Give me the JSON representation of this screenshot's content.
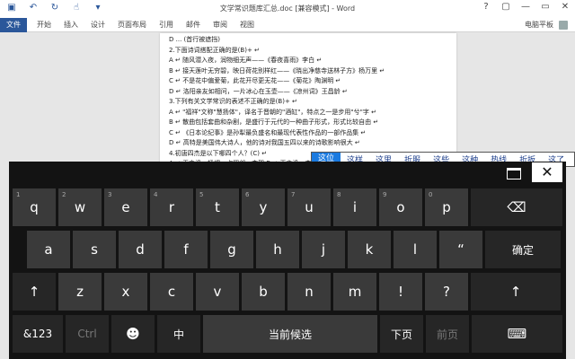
{
  "word": {
    "title": "文学常识题库汇总.doc [兼容模式] - Word",
    "file_tab": "文件",
    "tabs": [
      "开始",
      "插入",
      "设计",
      "页面布局",
      "引用",
      "邮件",
      "审阅",
      "视图"
    ],
    "user": "电脑平板",
    "qat_icons": [
      "save-icon",
      "undo-icon",
      "redo-icon",
      "touch-mode-icon",
      "customize-icon"
    ],
    "window_buttons": [
      "?",
      "▢",
      "—",
      "▭",
      "✕"
    ],
    "doc_lines": [
      "D  ... (首行被遮挡)",
      "2.下面诗词搭配正确的是(B)+ ↵",
      "A ↵ 随风潜入夜，润物细无声——《春夜喜雨》李白 ↵",
      "B ↵ 接天莲叶无穷碧，映日荷花别样红——《晓出净慈寺送林子方》杨万里 ↵",
      "C ↵ 不是花中偏爱菊，此花开尽更无花——《菊花》陶渊明 ↵",
      "D ↵ 洛阳亲友如相问，一片冰心在玉壶——《凉州词》王昌龄 ↵",
      "3.下列有关文学常识的表述不正确的是(B)+ ↵",
      "A ↵ \"福祥\"文称\"慧扬体\"，译名于晋朝的\"酒缸\"，特点之一是步用\"兮\"字 ↵",
      "B ↵ 散曲包括套曲和杂剧，是盛行于元代的一种曲子形式，形式比较自由 ↵",
      "C ↵ 《日本论纪事》是孙犁最负盛名和最现代表性作品的一部作品集 ↵",
      "D ↵ 高特是美国伟大诗人，他的诗对我国五四以来的诗歌影响很大 ↵",
      "4.初唐四杰是以下哪四个人？(C) ↵",
      "A ↵ 王之涣、杨炯、卢照邻、李贺 B ↵ 王之涣、李贺、孟浩然、王维 .sbt ↵",
      "C ↵ 王勃、杨炯、卢照邻、骆宾王 D ↵ 王勃、李贺、高适、孟浩然 ..."
    ]
  },
  "candidates": [
    "这位",
    "这样",
    "这里",
    "折服",
    "这些",
    "这种",
    "热线",
    "折扳",
    "这了"
  ],
  "keyboard": {
    "close_label": "✕",
    "row1": [
      {
        "char": "q",
        "num": "1"
      },
      {
        "char": "w",
        "num": "2"
      },
      {
        "char": "e",
        "num": "3"
      },
      {
        "char": "r",
        "num": "4"
      },
      {
        "char": "t",
        "num": "5"
      },
      {
        "char": "y",
        "num": "6"
      },
      {
        "char": "u",
        "num": "7"
      },
      {
        "char": "i",
        "num": "8"
      },
      {
        "char": "o",
        "num": "9"
      },
      {
        "char": "p",
        "num": "0"
      }
    ],
    "backspace": "⌫",
    "row2": [
      "a",
      "s",
      "d",
      "f",
      "g",
      "h",
      "j",
      "k",
      "l",
      "“"
    ],
    "enter": "确定",
    "shift": "↑",
    "row3": [
      "z",
      "x",
      "c",
      "v",
      "b",
      "n",
      "m",
      "!",
      "?"
    ],
    "shift_right": "↑",
    "sym": "&123",
    "ctrl": "Ctrl",
    "emoji": "☻",
    "lang": "中",
    "space": "当前候选",
    "next_page": "下页",
    "prev_page": "前页",
    "ime_switch": "⌨"
  }
}
